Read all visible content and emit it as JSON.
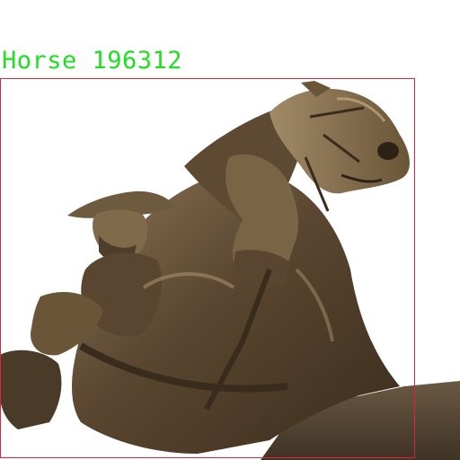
{
  "detection": {
    "label": "Horse 196312",
    "box_color": "#d7263d",
    "label_color": "#22dd22"
  },
  "scene": {
    "subject": "bronze-equestrian-statue",
    "background_color": "#ffffff"
  }
}
